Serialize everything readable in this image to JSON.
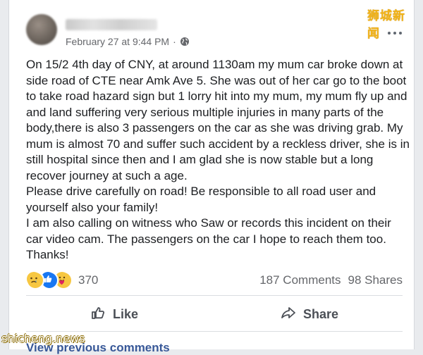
{
  "watermark": "狮城新闻",
  "post": {
    "timestamp": "February 27 at 9:44 PM",
    "separator": "·",
    "paragraphs": [
      "On 15/2 4th day of CNY, at around 1130am my mum car broke down at side road of CTE near Amk Ave 5. She was out of her car go to the boot to take road hazard sign but 1 lorry hit into my mum, my mum fly up and and land suffering very serious multiple injuries in many parts of the body,there is also 3 passengers on the car as she was driving grab. My mum is almost 70 and suffer such accident by a reckless driver, she is in still hospital since then and I am glad she is now stable but a long recover journey at such a age.",
      "Please drive carefully on road! Be responsible to all road user and yourself also your family!",
      "I am also calling on witness who Saw or records this incident on their car video cam. The passengers on the car I hope to reach them too. Thanks!"
    ]
  },
  "stats": {
    "reaction_count": "370",
    "comments": "187 Comments",
    "shares": "98 Shares"
  },
  "actions": {
    "like_label": "Like",
    "share_label": "Share"
  },
  "comments": {
    "view_previous": "View previous comments"
  },
  "footer_watermark": "shicheng.news"
}
